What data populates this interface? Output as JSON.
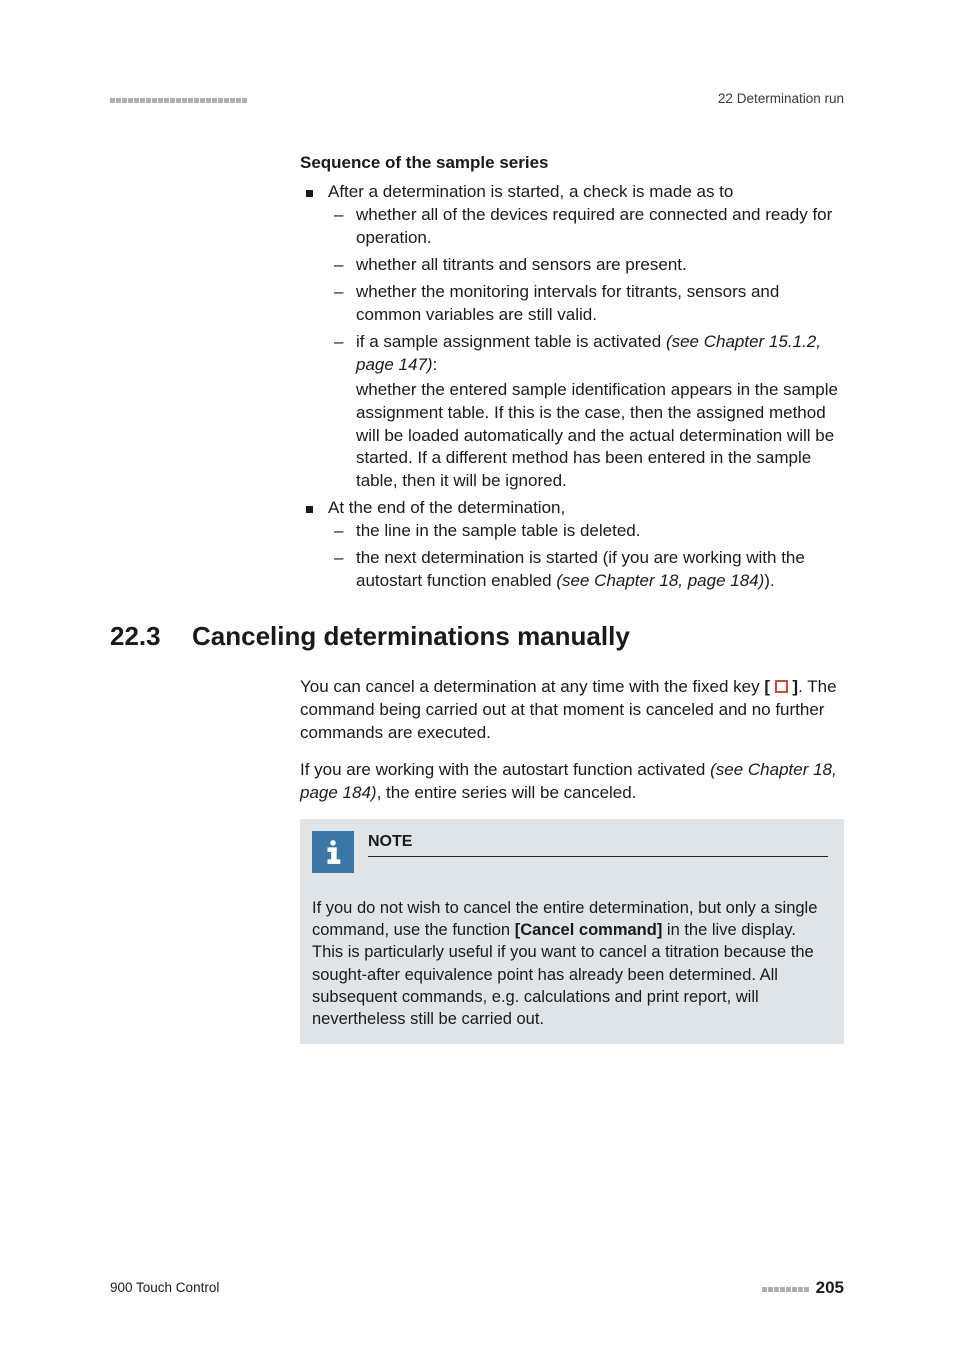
{
  "header": {
    "section": "22 Determination run"
  },
  "s1": {
    "title": "Sequence of the sample series",
    "b1": "After a determination is started, a check is made as to",
    "b1d1": "whether all of the devices required are connected and ready for operation.",
    "b1d2": "whether all titrants and sensors are present.",
    "b1d3": "whether the monitoring intervals for titrants, sensors and common variables are still valid.",
    "b1d4a": "if a sample assignment table is activated ",
    "b1d4ref": "(see Chapter 15.1.2, page 147)",
    "b1d4colon": ":",
    "b1d4b": "whether the entered sample identification appears in the sample assignment table. If this is the case, then the assigned method will be loaded automatically and the actual determination will be started. If a different method has been entered in the sample table, then it will be ignored.",
    "b2": "At the end of the determination,",
    "b2d1": "the line in the sample table is deleted.",
    "b2d2a": "the next determination is started (if you are working with the autostart function enabled ",
    "b2d2ref": "(see Chapter 18, page 184)",
    "b2d2b": ")."
  },
  "h2": {
    "num": "22.3",
    "title": "Canceling determinations manually"
  },
  "s2": {
    "p1a": "You can cancel a determination at any time with the fixed key ",
    "p1key1": "[ ",
    "p1key2": " ]",
    "p1b": ". The command being carried out at that moment is canceled and no further commands are executed.",
    "p2a": "If you are working with the autostart function activated ",
    "p2ref": "(see Chapter 18, page 184)",
    "p2b": ", the entire series will be canceled."
  },
  "note": {
    "title": "NOTE",
    "body_a": "If you do not wish to cancel the entire determination, but only a single command, use the function ",
    "body_bold": "[Cancel command]",
    "body_b": " in the live display. This is particularly useful if you want to cancel a titration because the sought-after equivalence point has already been determined. All subsequent commands, e.g. calculations and print report, will nevertheless still be carried out."
  },
  "footer": {
    "product": "900 Touch Control",
    "page": "205"
  }
}
